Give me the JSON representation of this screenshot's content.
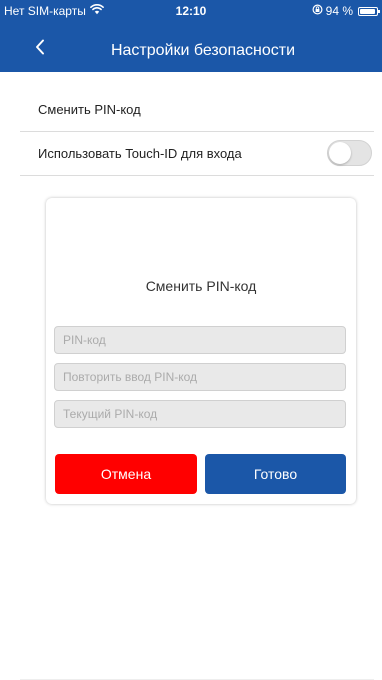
{
  "status_bar": {
    "carrier": "Нет SIM-карты",
    "time": "12:10",
    "battery_text": "94 %",
    "battery_level": 0.94,
    "wifi_icon": "wifi-icon",
    "lock_icon": "orientation-lock-icon"
  },
  "nav": {
    "title": "Настройки безопасности",
    "back_icon": "chevron-left-icon"
  },
  "settings": {
    "items": [
      {
        "label": "Сменить PIN-код"
      },
      {
        "label": "Использовать Touch-ID для входа",
        "toggle_on": false
      }
    ]
  },
  "modal": {
    "title": "Сменить PIN-код",
    "fields": [
      {
        "value": "",
        "placeholder": "PIN-код"
      },
      {
        "value": "",
        "placeholder": "Повторить ввод PIN-код"
      },
      {
        "value": "",
        "placeholder": "Текущий PIN-код"
      }
    ],
    "cancel_label": "Отмена",
    "done_label": "Готово"
  },
  "colors": {
    "brand_blue": "#1b57a8",
    "cancel_red": "#ff0000"
  }
}
